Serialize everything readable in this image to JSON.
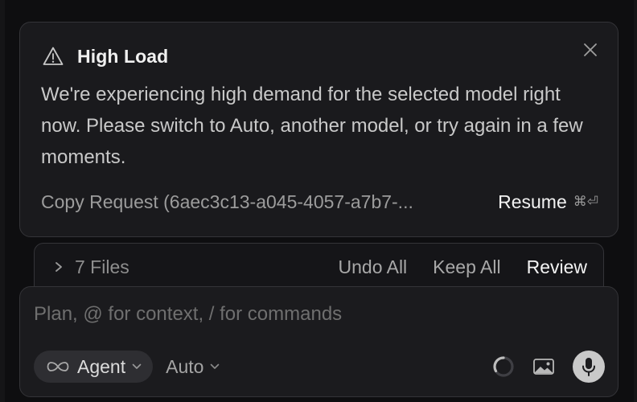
{
  "alert": {
    "title": "High Load",
    "message": "We're experiencing high demand for the selected model right now. Please switch to Auto, another model, or try again in a few moments.",
    "copy_request": "Copy Request (6aec3c13-a045-4057-a7b7-...",
    "resume_label": "Resume",
    "resume_shortcut": "⌘⏎",
    "icon": "warning-triangle-icon"
  },
  "files_bar": {
    "label": "7 Files",
    "undo_all": "Undo All",
    "keep_all": "Keep All",
    "review": "Review"
  },
  "composer": {
    "placeholder": "Plan, @ for context, / for commands",
    "value": "",
    "mode": "Agent",
    "mode_icon": "infinity-icon",
    "model": "Auto"
  },
  "colors": {
    "background": "#0e0e10",
    "card": "#1a1a1d",
    "border": "#343438",
    "pill": "#2e2e32",
    "mic_button": "#c9c9c9"
  }
}
